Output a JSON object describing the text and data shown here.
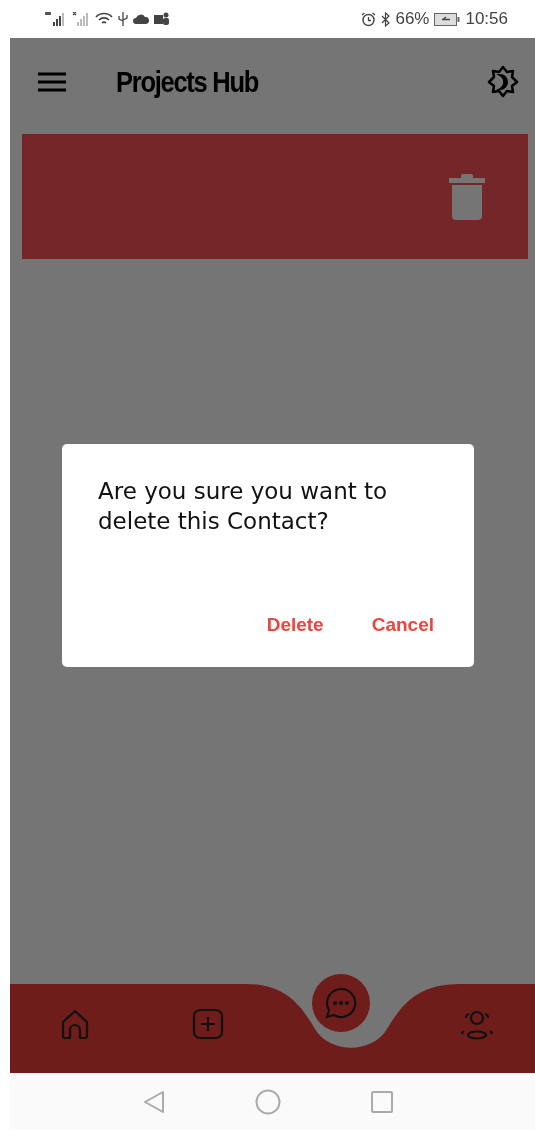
{
  "status_bar": {
    "battery": "66%",
    "time": "10:56"
  },
  "app_bar": {
    "title": "Projects Hub"
  },
  "dialog": {
    "message": "Are you sure you want to delete this Contact?",
    "buttons": [
      "Delete",
      "Cancel"
    ]
  }
}
